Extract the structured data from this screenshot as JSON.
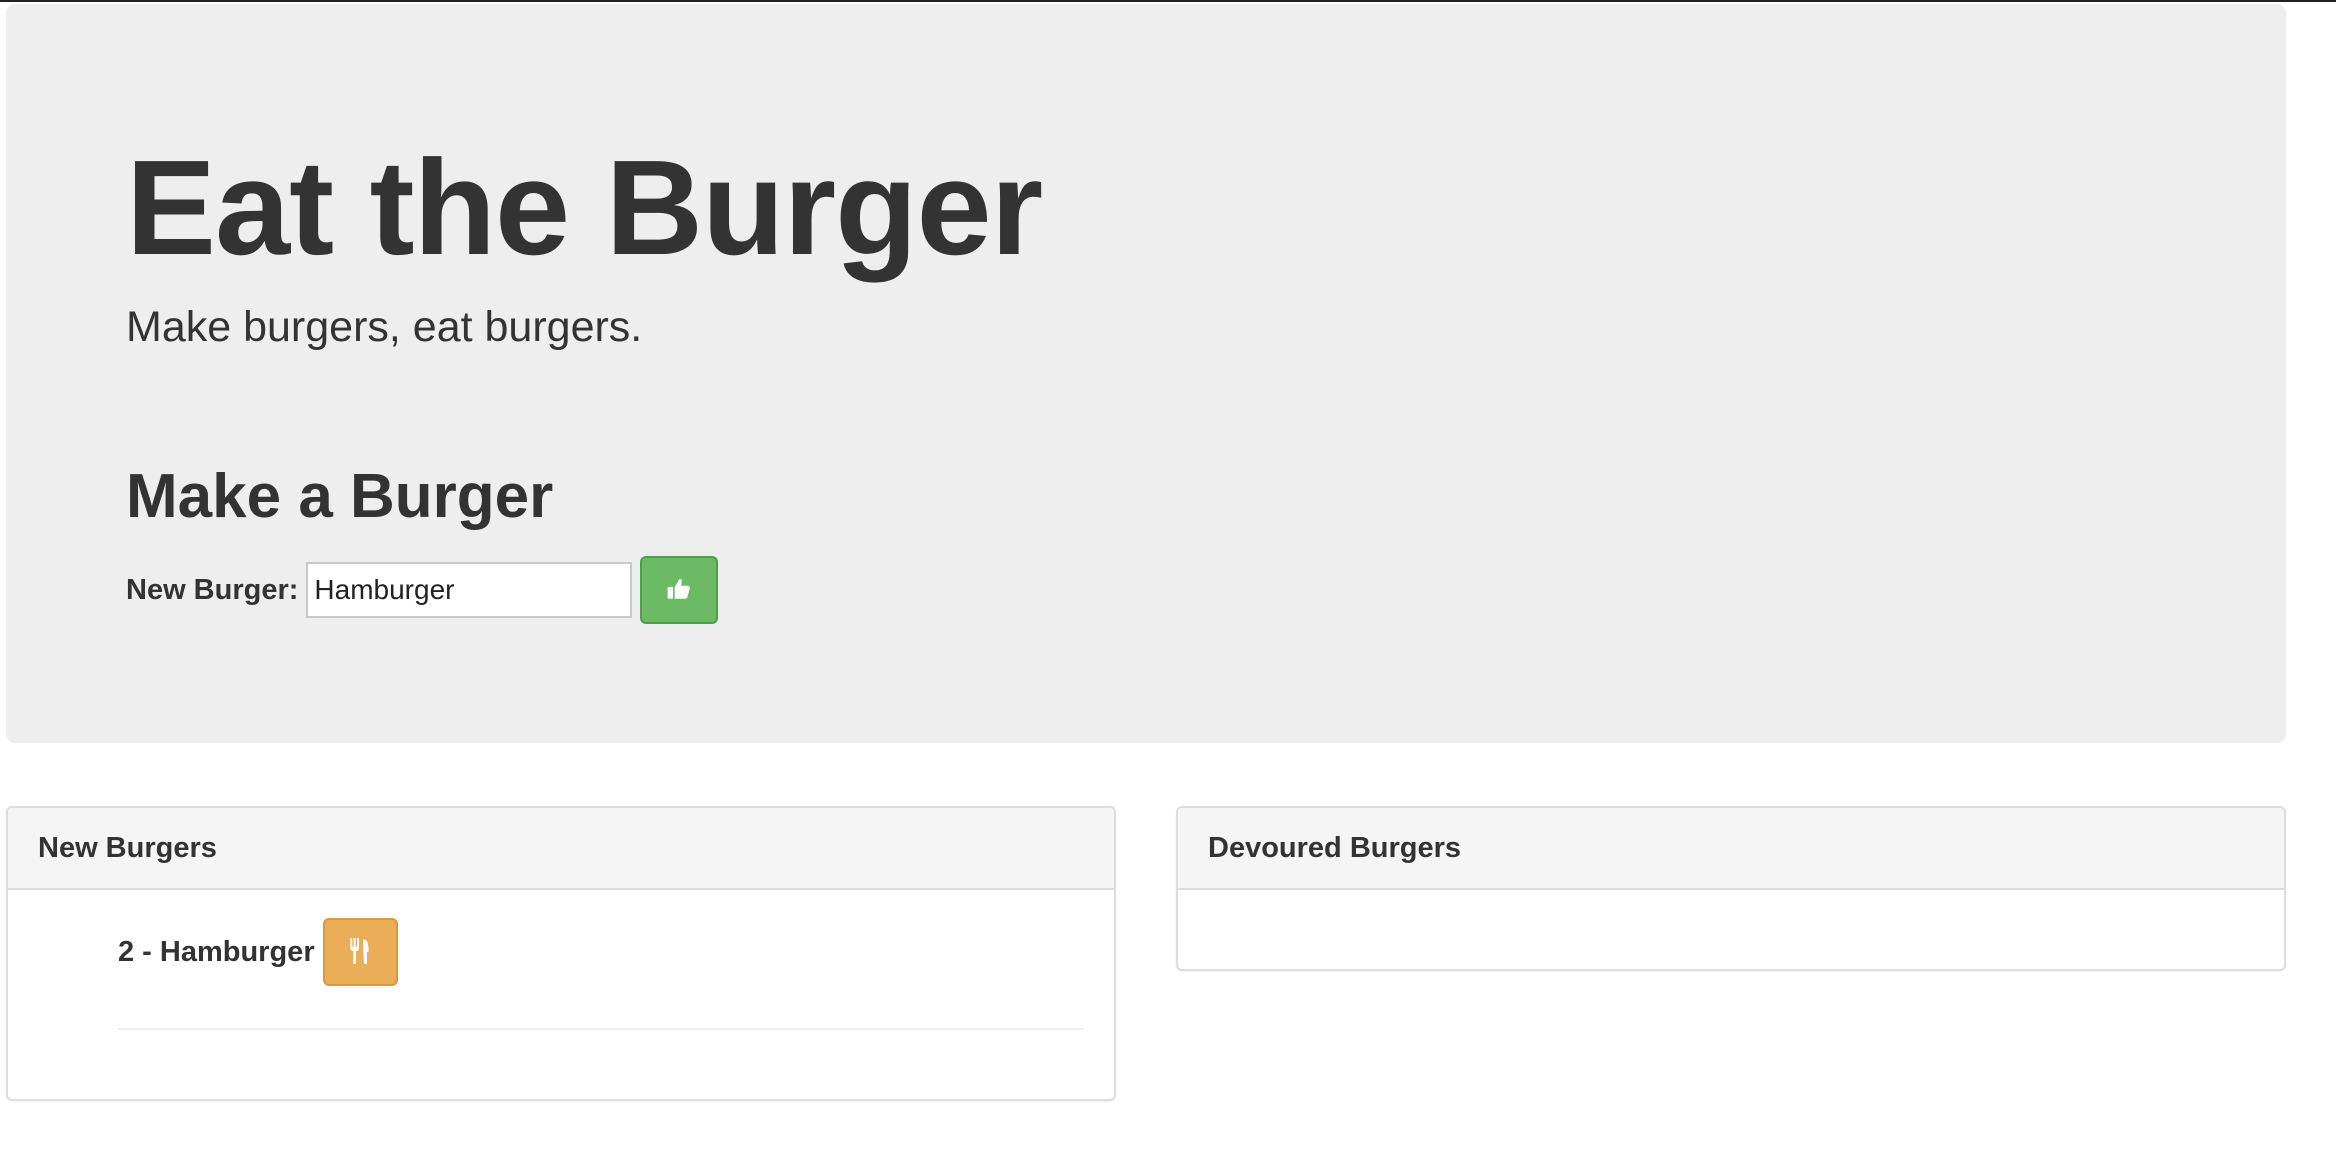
{
  "header": {
    "title": "Eat the Burger",
    "subtitle": "Make burgers, eat burgers."
  },
  "form": {
    "heading": "Make a Burger",
    "label": "New Burger:",
    "input_value": "Hamburger",
    "submit_icon": "thumbs-up-icon"
  },
  "new_burgers": {
    "heading": "New Burgers",
    "items": [
      {
        "label": "2 - Hamburger",
        "action_icon": "cutlery-icon"
      }
    ]
  },
  "devoured_burgers": {
    "heading": "Devoured Burgers",
    "items": []
  },
  "colors": {
    "jumbotron_bg": "#eeeeee",
    "success_button": "#6cb966",
    "warning_button": "#e9ae57",
    "text": "#333333"
  }
}
